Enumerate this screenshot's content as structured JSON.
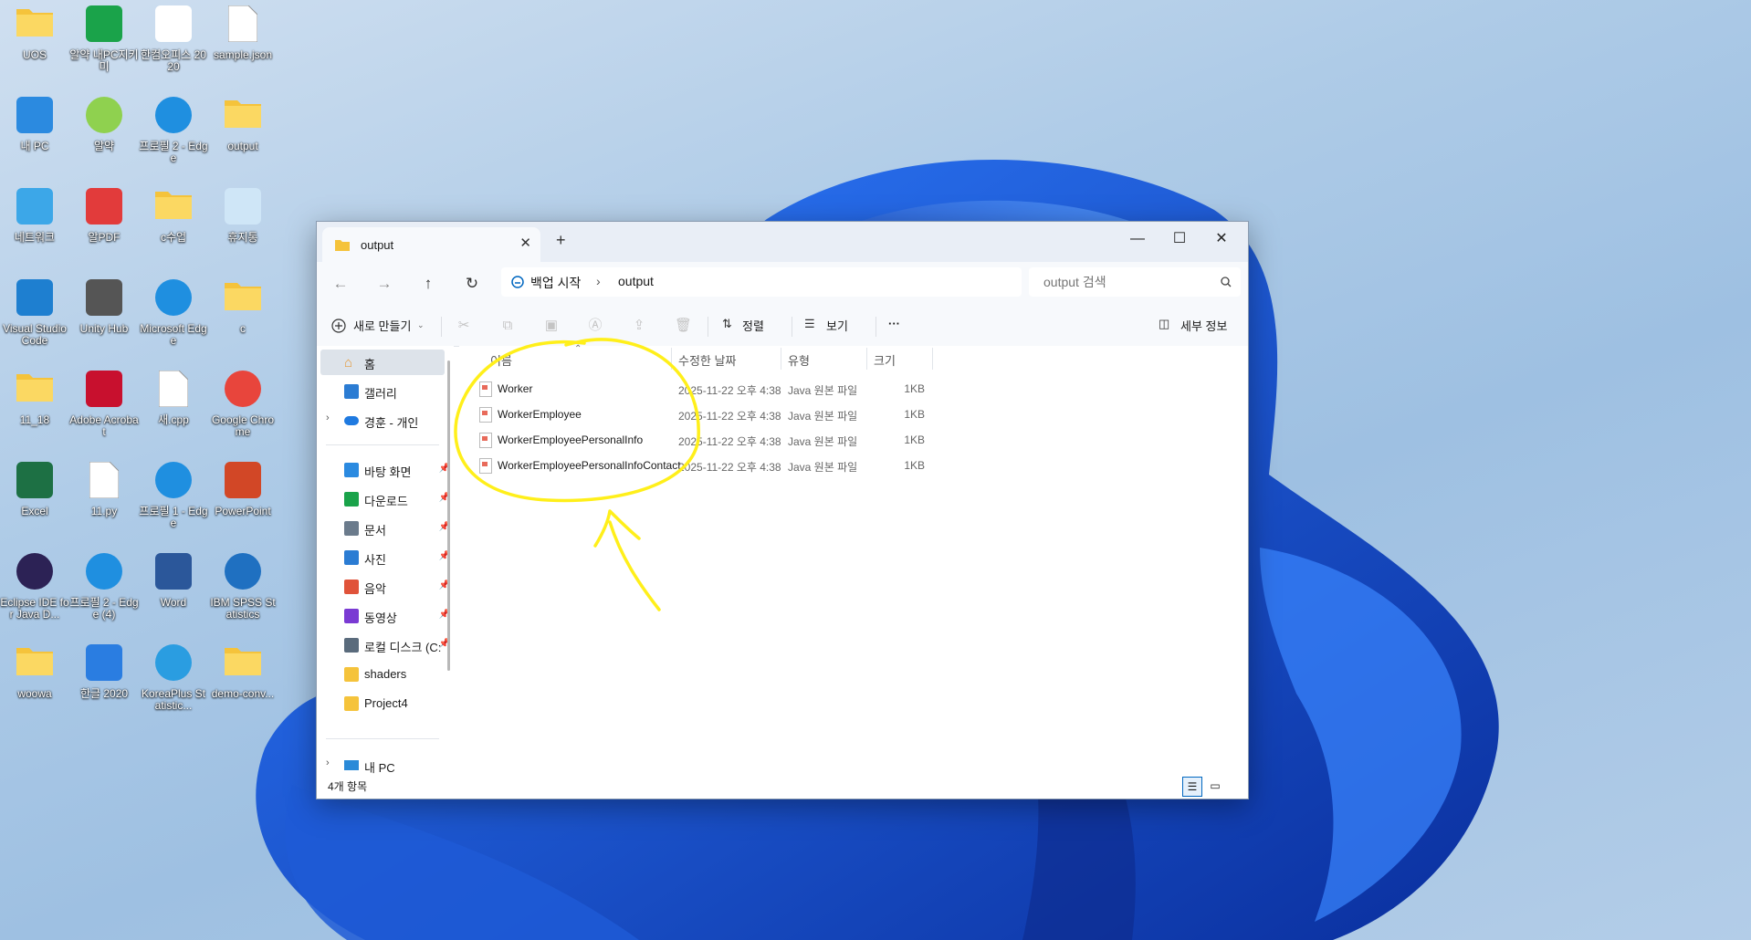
{
  "desktop": {
    "icons": [
      {
        "label": "UOS",
        "icon": "folder-icon"
      },
      {
        "label": "알약 내PC지키미",
        "icon": "shield-plus-icon"
      },
      {
        "label": "한컴오피스 2020",
        "icon": "hancom-office-icon"
      },
      {
        "label": "sample.json",
        "icon": "file-icon"
      },
      {
        "label": "내 PC",
        "icon": "monitor-icon"
      },
      {
        "label": "알약",
        "icon": "alyac-icon"
      },
      {
        "label": "프로필 2 - Edge",
        "icon": "edge-icon"
      },
      {
        "label": "output",
        "icon": "folder-icon"
      },
      {
        "label": "네트워크",
        "icon": "network-icon"
      },
      {
        "label": "알PDF",
        "icon": "pdf-icon"
      },
      {
        "label": "c수업",
        "icon": "folder-icon"
      },
      {
        "label": "휴지통",
        "icon": "recycle-bin-icon"
      },
      {
        "label": "Visual Studio Code",
        "icon": "vscode-icon"
      },
      {
        "label": "Unity Hub",
        "icon": "unity-icon"
      },
      {
        "label": "Microsoft Edge",
        "icon": "edge-icon"
      },
      {
        "label": "c",
        "icon": "folder-icon"
      },
      {
        "label": "11_18",
        "icon": "folder-icon"
      },
      {
        "label": "Adobe Acrobat",
        "icon": "acrobat-icon"
      },
      {
        "label": "새.cpp",
        "icon": "file-icon"
      },
      {
        "label": "Google Chrome",
        "icon": "chrome-icon"
      },
      {
        "label": "Excel",
        "icon": "excel-icon"
      },
      {
        "label": "11.py",
        "icon": "file-icon"
      },
      {
        "label": "프로필 1 - Edge",
        "icon": "edge-icon"
      },
      {
        "label": "PowerPoint",
        "icon": "powerpoint-icon"
      },
      {
        "label": "Eclipse IDE for Java D...",
        "icon": "eclipse-icon"
      },
      {
        "label": "프로필 2 - Edge (4)",
        "icon": "edge-icon"
      },
      {
        "label": "Word",
        "icon": "word-icon"
      },
      {
        "label": "IBM SPSS Statistics",
        "icon": "spss-icon"
      },
      {
        "label": "woowa",
        "icon": "folder-icon"
      },
      {
        "label": "한글 2020",
        "icon": "hangul-icon"
      },
      {
        "label": "KoreaPlus Statistic...",
        "icon": "koreaplus-icon"
      },
      {
        "label": "demo-conv...",
        "icon": "folder-icon"
      }
    ]
  },
  "window": {
    "tab_title": "output",
    "new_tab": "+",
    "controls": {
      "minimize": "—",
      "maximize": "☐",
      "close": "✕"
    },
    "nav": {
      "back": "←",
      "forward": "→",
      "up": "↑",
      "refresh": "↻"
    },
    "address": {
      "root": "백업 시작",
      "separator": "›",
      "current": "output"
    },
    "search": {
      "placeholder": "output 검색"
    },
    "commands": {
      "new": "새로 만들기",
      "sort": "정렬",
      "view": "보기",
      "more": "···",
      "details": "세부 정보"
    },
    "sidebar": {
      "home": "홈",
      "gallery": "갤러리",
      "onedrive": "경훈 - 개인",
      "quick": [
        {
          "label": "바탕 화면",
          "icon": "desktop-icon"
        },
        {
          "label": "다운로드",
          "icon": "download-icon"
        },
        {
          "label": "문서",
          "icon": "document-icon"
        },
        {
          "label": "사진",
          "icon": "picture-icon"
        },
        {
          "label": "음악",
          "icon": "music-icon"
        },
        {
          "label": "동영상",
          "icon": "video-icon"
        },
        {
          "label": "로컬 디스크 (C:",
          "icon": "drive-icon"
        },
        {
          "label": "shaders",
          "icon": "folder-icon"
        },
        {
          "label": "Project4",
          "icon": "folder-icon"
        }
      ],
      "this_pc": "내 PC"
    },
    "columns": {
      "name": "이름",
      "modified": "수정한 날짜",
      "type": "유형",
      "size": "크기"
    },
    "files": [
      {
        "name": "Worker",
        "modified": "2025-11-22 오후 4:38",
        "type": "Java 원본 파일",
        "size": "1KB"
      },
      {
        "name": "WorkerEmployee",
        "modified": "2025-11-22 오후 4:38",
        "type": "Java 원본 파일",
        "size": "1KB"
      },
      {
        "name": "WorkerEmployeePersonalInfo",
        "modified": "2025-11-22 오후 4:38",
        "type": "Java 원본 파일",
        "size": "1KB"
      },
      {
        "name": "WorkerEmployeePersonalInfoContact",
        "modified": "2025-11-22 오후 4:38",
        "type": "Java 원본 파일",
        "size": "1KB"
      }
    ],
    "status": "4개 항목"
  },
  "colors": {
    "annotation": "#ffef1a",
    "accent": "#0067c0",
    "wallpaper": "#1565e8"
  }
}
